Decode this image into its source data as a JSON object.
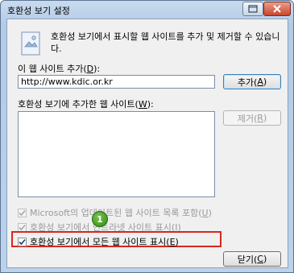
{
  "window": {
    "title": "호환성 보기 설정"
  },
  "info": {
    "text": "호환성 보기에서 표시할 웹 사이트를 추가 및 제거할 수 있습니다."
  },
  "add_site": {
    "label_prefix": "이 웹 사이트 추가(",
    "label_key": "D",
    "label_suffix": "):",
    "value": "http://www.kdic.or.kr",
    "button_prefix": "추가(",
    "button_key": "A",
    "button_suffix": ")"
  },
  "list": {
    "label_prefix": "호환성 보기에 추가한 웹 사이트(",
    "label_key": "W",
    "label_suffix": "):",
    "items": [],
    "remove_prefix": "제거(",
    "remove_key": "R",
    "remove_suffix": ")"
  },
  "options": {
    "opt1_prefix": "Microsoft의 업데이트된 웹 사이트 목록 포함(",
    "opt1_key": "U",
    "opt1_suffix": ")",
    "opt1_checked": true,
    "opt1_enabled": false,
    "opt2_prefix": "호환성 보기에서 인트라넷 사이트 표시(",
    "opt2_key": "I",
    "opt2_suffix": ")",
    "opt2_checked": true,
    "opt2_enabled": false,
    "opt3_prefix": "호환성 보기에서 모든 웹 사이트 표시(",
    "opt3_key": "E",
    "opt3_suffix": ")",
    "opt3_checked": true,
    "opt3_enabled": true
  },
  "annotation": {
    "step": "1",
    "highlight_color": "#d9261c"
  },
  "close": {
    "prefix": "닫기(",
    "key": "C",
    "suffix": ")"
  }
}
